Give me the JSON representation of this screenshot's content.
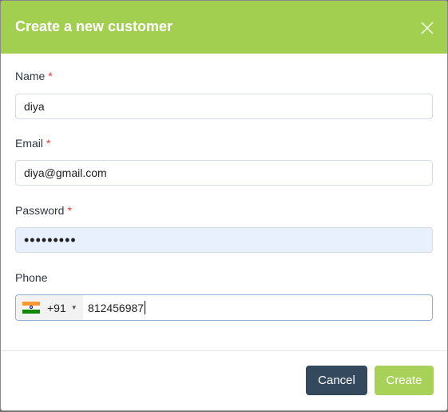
{
  "modal": {
    "title": "Create a new customer",
    "close_icon": "close-icon"
  },
  "form": {
    "name": {
      "label": "Name",
      "required": "*",
      "value": "diya"
    },
    "email": {
      "label": "Email",
      "required": "*",
      "value": "diya@gmail.com"
    },
    "password": {
      "label": "Password",
      "required": "*",
      "value": "•••••••••"
    },
    "phone": {
      "label": "Phone",
      "country_code": "+91",
      "flag": "india-flag-icon",
      "value": "812456987"
    }
  },
  "footer": {
    "cancel_label": "Cancel",
    "create_label": "Create"
  },
  "colors": {
    "header_bg": "#a2cf4f",
    "cancel_bg": "#34495e",
    "create_bg": "#a8d15a",
    "required": "#e53935"
  }
}
